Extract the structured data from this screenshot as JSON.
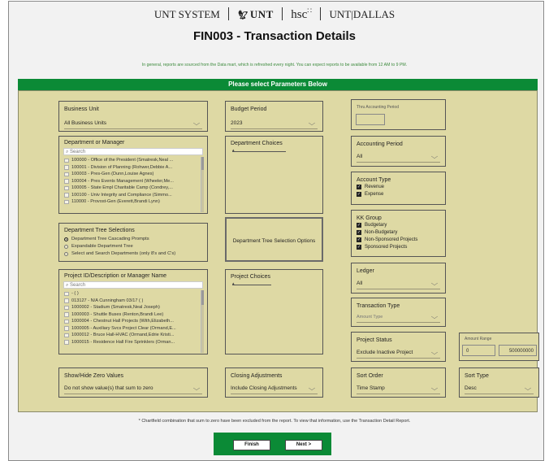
{
  "header": {
    "logo_unt_system": "UNT SYSTEM",
    "logo_unt": "UNT",
    "logo_hsc": "hsc",
    "logo_unt_dallas": "UNT|DALLAS",
    "title": "FIN003 - Transaction Details",
    "notice": "In general, reports are sourced from the Data mart, which is refreshed every night. You can expect reports to be available from 12 AM to 9 PM."
  },
  "parameters_header": "Please select Parameters Below",
  "business_unit": {
    "label": "Business Unit",
    "value": "All Business Units"
  },
  "budget_period": {
    "label": "Budget Period",
    "value": "2023"
  },
  "thru_accounting_period": {
    "label": "Thru Accounting Period",
    "value": ""
  },
  "department_or_manager": {
    "label": "Department or Manager",
    "search_placeholder": "Search",
    "items": [
      "100000 - Office of the President (Smatresk,Neal ...",
      "100001 - Division of Planning (Rohwer,Debbie A...",
      "100003 - Pres-Gen (Dunn,Louise Agnes)",
      "100004 - Pres Events Management (Wheeler,Me...",
      "100005 - State Empl Charitable Camp (Condrey,...",
      "100100 - Univ Integrity and Compliance (Simmo...",
      "110000 - Provost-Gen (Everett,Brandi Lynn)"
    ]
  },
  "department_choices": {
    "label": "Department Choices"
  },
  "accounting_period": {
    "label": "Accounting Period",
    "value": "All"
  },
  "account_type": {
    "label": "Account Type",
    "options": [
      "Revenue",
      "Expense"
    ]
  },
  "kk_group": {
    "label": "KK Group",
    "options": [
      "Budgetary",
      "Non-Budgetary",
      "Non-Sponsored Projects",
      "Sponsored Projects"
    ]
  },
  "department_tree_selections": {
    "label": "Department Tree Selections",
    "options": [
      "Department Tree Cascading Prompts",
      "Expandable Department Tree",
      "Select and Search Departments (only 8's and C's)"
    ],
    "selected_index": 0
  },
  "department_tree_button": "Department Tree Selection Options",
  "ledger": {
    "label": "Ledger",
    "value": "All"
  },
  "project": {
    "label": "Project ID/Description or Manager Name",
    "search_placeholder": "Search",
    "items": [
      "- ( )",
      "013127 - N/A Cunningham 03/17 ( )",
      "1000002 - Stadium (Smatresk,Neal Joseph)",
      "1000003 - Shuttle Buses (Renton,Brandi Lee)",
      "1000004 - Chestnut Hall Projects (With,Elizabeth...",
      "1000005 - Auxiliary Svcs Project Clear (Ormand,E...",
      "1000012 - Bruce Hall-HVAC (Ormand,Edrie Kristi...",
      "1000015 - Residence Hall Fire Sprinklers (Orman..."
    ]
  },
  "project_choices": {
    "label": "Project Choices"
  },
  "transaction_type": {
    "label": "Transaction Type",
    "placeholder": "Amount Type"
  },
  "project_status": {
    "label": "Project Status",
    "value": "Exclude Inactive Project"
  },
  "amount_range": {
    "label": "Amount Range",
    "min": "0",
    "max": "500000000"
  },
  "show_hide_zero": {
    "label": "Show/Hide Zero Values",
    "value": "Do not show value(s) that sum to zero"
  },
  "closing_adjustments": {
    "label": "Closing Adjustments",
    "value": "Include Closing Adjustments"
  },
  "sort_order": {
    "label": "Sort Order",
    "value": "Time Stamp"
  },
  "sort_type": {
    "label": "Sort Type",
    "value": "Desc"
  },
  "footnote": "* Chartfield combination that sum to zero have been excluded from the report. To view that information, use the Transaction Detail Report.",
  "buttons": {
    "finish": "Finish",
    "next": "Next >"
  },
  "colors": {
    "green": "#0b8a36",
    "panel": "#ded9a4"
  },
  "icons": {
    "dropdown": "chevron-down-icon",
    "search": "search-icon",
    "check": "checkmark-icon"
  }
}
